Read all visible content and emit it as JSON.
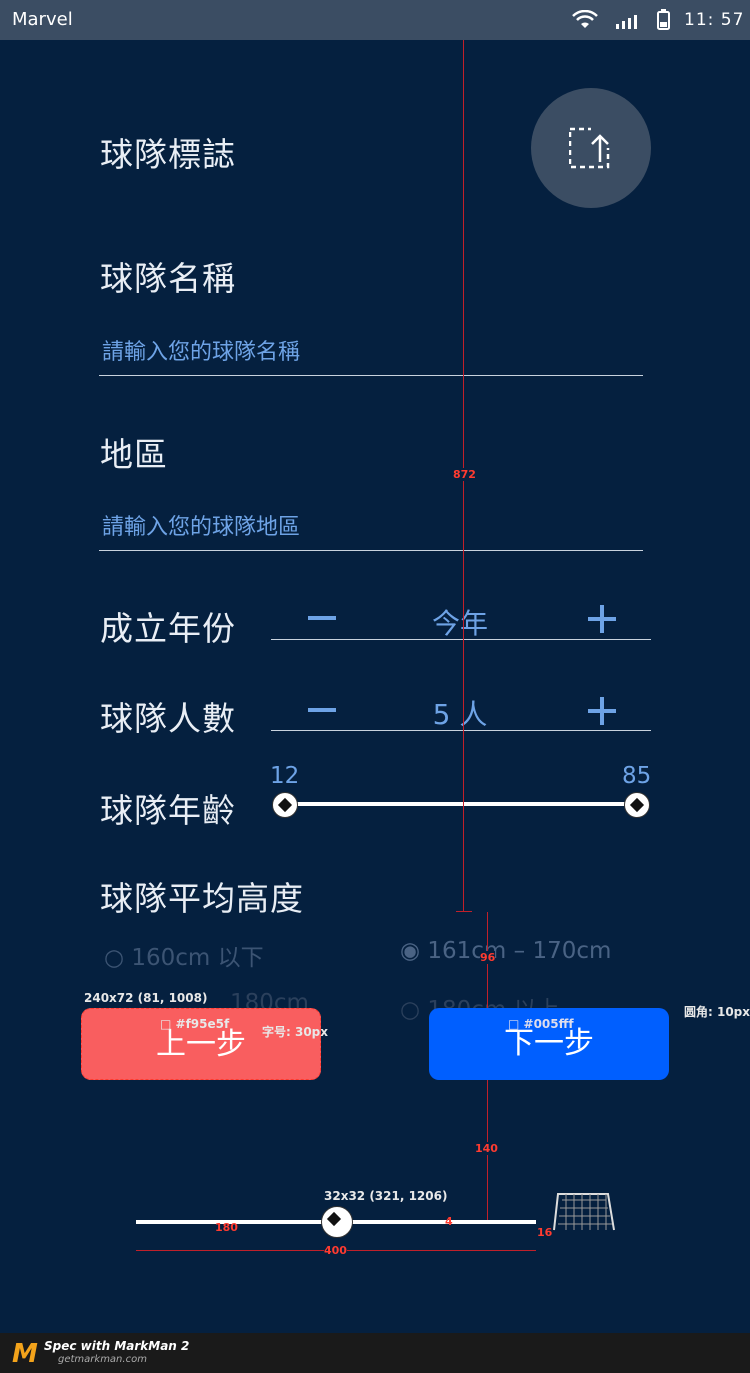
{
  "status_bar": {
    "app_name": "Marvel",
    "time": "11: 57"
  },
  "form": {
    "logo_label": "球隊標誌",
    "name_label": "球隊名稱",
    "name_placeholder": "請輸入您的球隊名稱",
    "region_label": "地區",
    "region_placeholder": "請輸入您的球隊地區",
    "founded": {
      "label": "成立年份",
      "value": "今年"
    },
    "members": {
      "label": "球隊人數",
      "value": "5 人"
    },
    "age": {
      "label": "球隊年齡",
      "min": "12",
      "max": "85"
    },
    "height": {
      "label": "球隊平均高度",
      "options": [
        "160cm 以下",
        "161cm – 170cm",
        "171cm – 180cm",
        "180cm 以上"
      ],
      "visible_options": [
        "160cm 以下",
        "161cm – 170cm",
        "180cm",
        "180cm 以上"
      ],
      "selected": "161cm – 170cm"
    }
  },
  "buttons": {
    "prev": "上一步",
    "next": "下一步"
  },
  "annotations": {
    "guide_872": "872",
    "guide_96": "96",
    "guide_140": "140",
    "prev_size": "240x72 (81, 1008)",
    "prev_color": "#f95e5f",
    "font_note": "字号: 30px",
    "next_color": "#005fff",
    "radius_note": "圆角: 10px",
    "ball_size": "32x32 (321, 1206)",
    "dist_180": "180",
    "dist_4": "4",
    "dist_16": "16",
    "dist_400": "400"
  },
  "colors": {
    "background": "#05203f",
    "prev_button": "#f95e5f",
    "next_button": "#005fff",
    "accent": "#6ea3e6"
  },
  "footer": {
    "brand": "Spec with MarkMan 2",
    "url": "getmarkman.com"
  }
}
